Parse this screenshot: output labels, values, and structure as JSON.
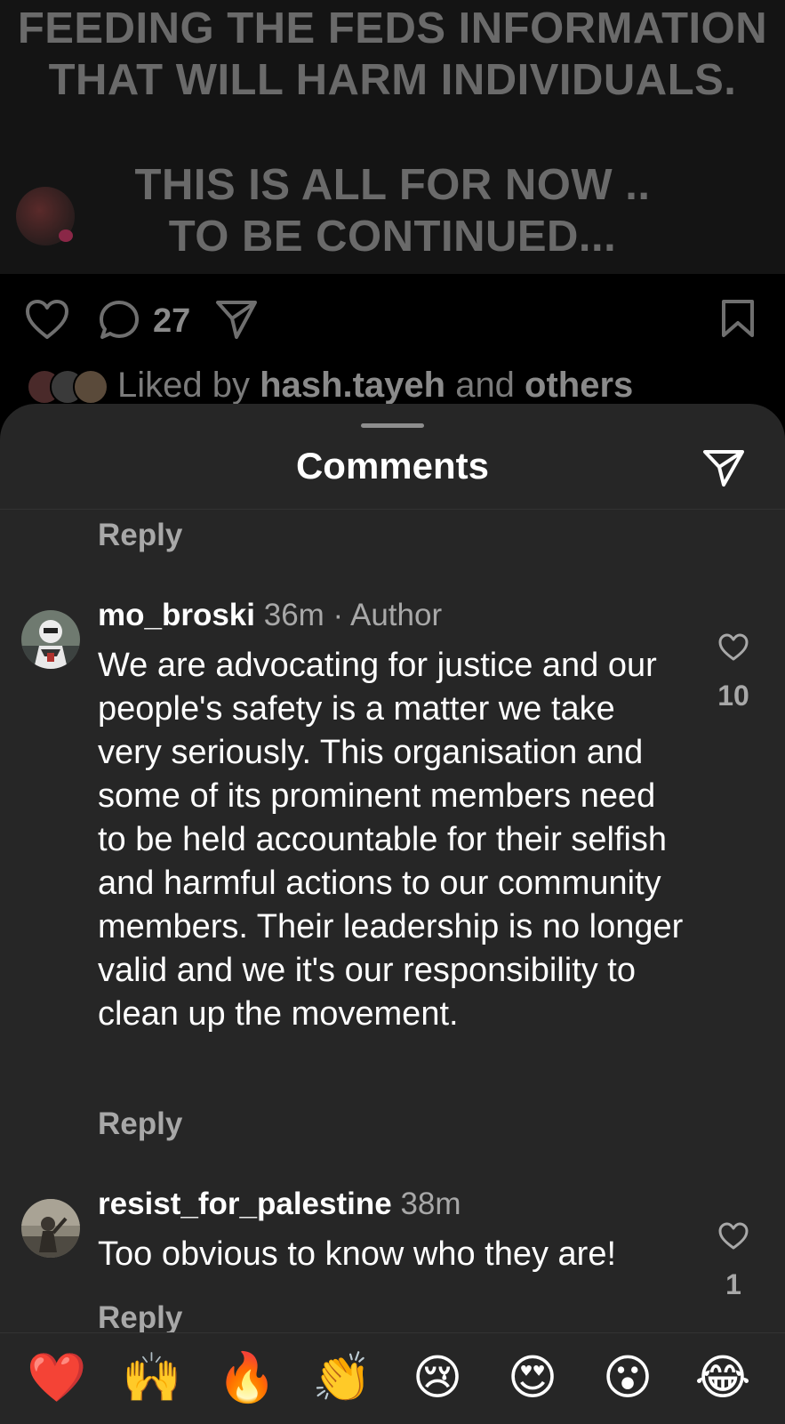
{
  "post": {
    "text_lines": [
      "FEEDING THE FEDS INFORMATION",
      "THAT WILL HARM INDIVIDUALS.",
      "THIS IS ALL FOR NOW ..",
      "TO BE CONTINUED..."
    ],
    "comment_count": "27",
    "liked_by_prefix": "Liked by ",
    "liked_by_user": "hash.tayeh",
    "liked_by_middle": " and ",
    "liked_by_others": "others"
  },
  "sheet": {
    "title": "Comments"
  },
  "comments": [
    {
      "reply_label": "Reply"
    },
    {
      "username": "mo_broski",
      "meta": " 36m · Author",
      "text": "We are advocating for justice and our people's safety is a matter we take very seriously. This organisation and some of its prominent members need to be held accountable for their selfish and harmful actions to our community members. Their leadership is no longer valid and we it's our responsibility to clean up the movement.",
      "likes": "10",
      "reply_label": "Reply"
    },
    {
      "username": "resist_for_palestine",
      "meta": " 38m",
      "text": "Too obvious to know who they are!",
      "likes": "1",
      "reply_label": "Reply"
    }
  ],
  "emoji_bar": [
    "❤️",
    "🙌",
    "🔥",
    "👏",
    "😢",
    "😍",
    "😮",
    "😂"
  ],
  "colors": {
    "sheet_bg": "#262626",
    "muted_text": "#a8a8a8"
  }
}
